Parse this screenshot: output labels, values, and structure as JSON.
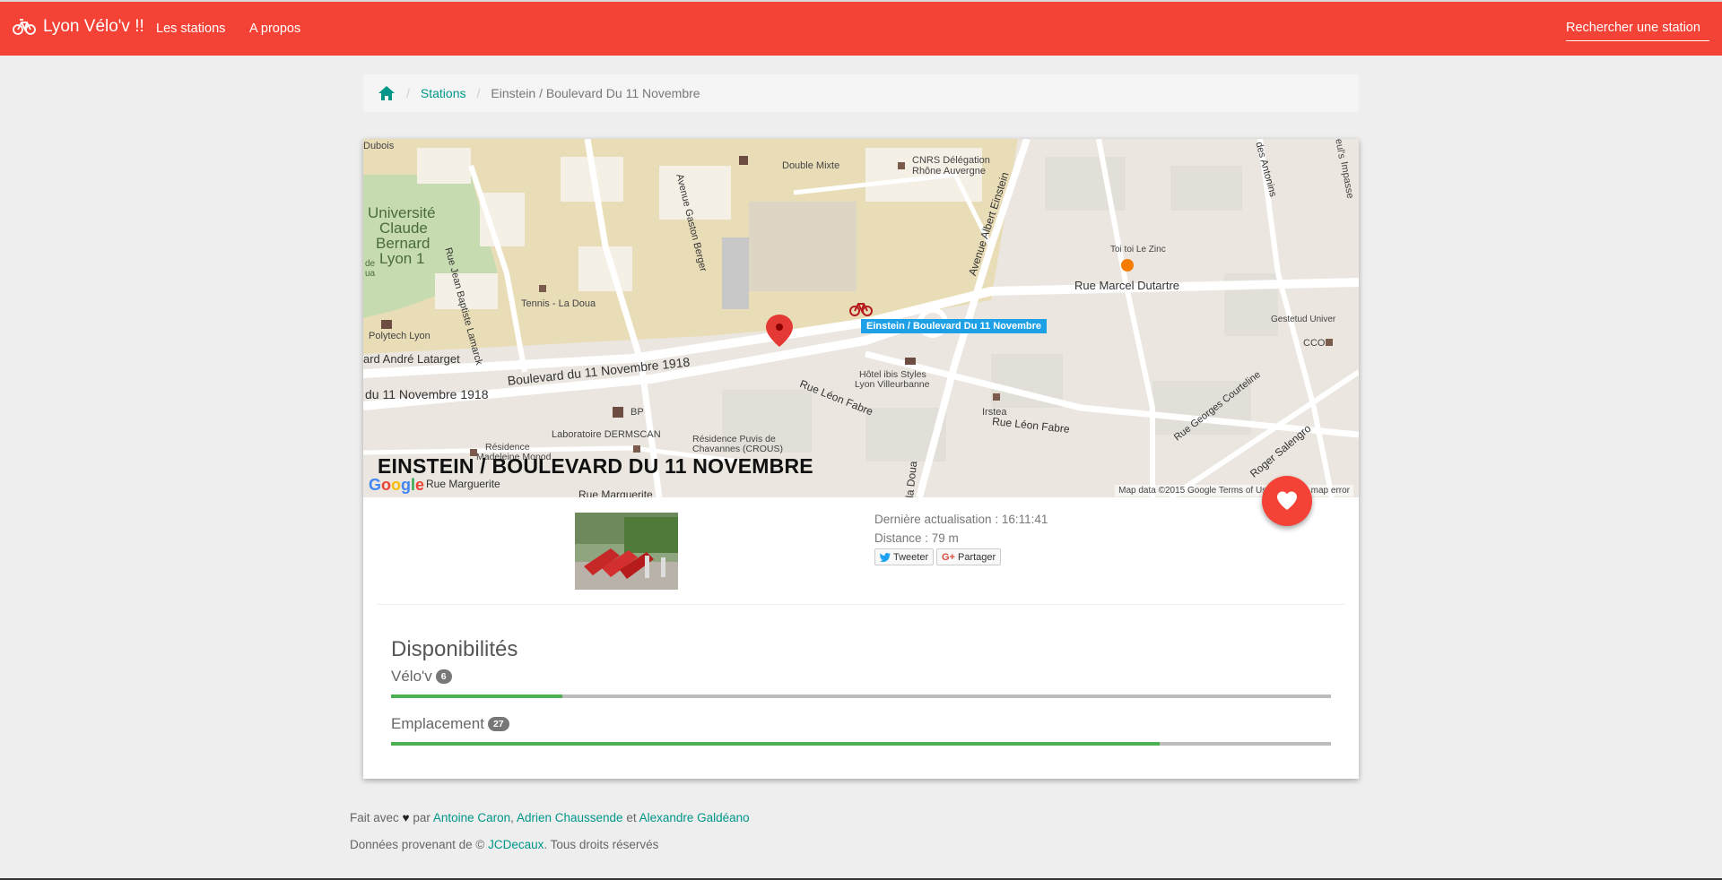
{
  "navbar": {
    "brand": "Lyon Vélo'v !!",
    "links": [
      "Les stations",
      "A propos"
    ],
    "search_placeholder": "Rechercher une station",
    "color": "#f44336"
  },
  "breadcrumb": {
    "home_icon": "home-icon",
    "stations": "Stations",
    "current": "Einstein / Boulevard Du 11 Novembre"
  },
  "map": {
    "title": "EINSTEIN / BOULEVARD DU 11 NOVEMBRE",
    "station_tag": "Einstein / Boulevard Du 11 Novembre",
    "google": "Google",
    "footer": "Map data ©2015 Google   Terms of Use   Report a map error",
    "labels": {
      "universite": "Université",
      "claude": "Claude",
      "bernard": "Bernard",
      "lyon1": "Lyon 1",
      "de": "de",
      "ua": "ua",
      "double_mixte": "Double Mixte",
      "cnrs1": "CNRS Délégation",
      "cnrs2": "Rhône Auvergne",
      "tennis": "Tennis - La Doua",
      "polytech": "Polytech Lyon",
      "toi_toi": "Toi toi Le Zinc",
      "cco": "CCO",
      "gestetud": "Gestetud Univer",
      "ibis1": "Hôtel ibis Styles",
      "ibis2": "Lyon Villeurbanne",
      "irstea": "Irstea",
      "bp": "BP",
      "dermscan": "Laboratoire DERMSCAN",
      "residence1": "Résidence",
      "residence2": "Madeleine Monod",
      "puvis1": "Résidence Puvis de",
      "puvis2": "Chavannes (CROUS)",
      "jubois": "Dubois",
      "euls": "eul's",
      "impasse": "Impasse"
    },
    "streets": {
      "jean_baptiste": "Rue Jean Baptiste Lamarck",
      "gaston_berger": "Avenue Gaston Berger",
      "albert_einstein": "Avenue Albert Einstein",
      "des_antonins": "des Antonins",
      "marcel_dutartre": "Rue Marcel Dutartre",
      "andre_latarget": "ard André Latarget",
      "bd_11_nov": "Boulevard du 11 Novembre 1918",
      "du_11_nov": "du 11 Novembre 1918",
      "leon_fabre1": "Rue Léon Fabre",
      "leon_fabre2": "Rue Léon Fabre",
      "georges_courteline": "Rue Georges Courteline",
      "roger_salengro": "Roger Salengro",
      "la_doua": "la Doua",
      "marguerite1": "Rue Marguerite",
      "marguerite2": "Rue Marguerite"
    }
  },
  "station": {
    "last_update": "Dernière actualisation : 16:11:41",
    "distance": "Distance : 79 m",
    "tweet": "Tweeter",
    "share": "Partager"
  },
  "availability": {
    "title": "Disponibilités",
    "bikes": {
      "label": "Vélo'v",
      "count": "6",
      "fraction": 0.1818
    },
    "slots": {
      "label": "Emplacement",
      "count": "27",
      "fraction": 0.8182
    }
  },
  "footer": {
    "made_with": "Fait avec",
    "by": "par",
    "author1": "Antoine Caron",
    "comma": ",",
    "author2": "Adrien Chaussende",
    "and": "et",
    "author3": "Alexandre Galdéano",
    "data_from": "Données provenant de ©",
    "jcdecaux": "JCDecaux",
    "rights": ". Tous droits réservés"
  }
}
